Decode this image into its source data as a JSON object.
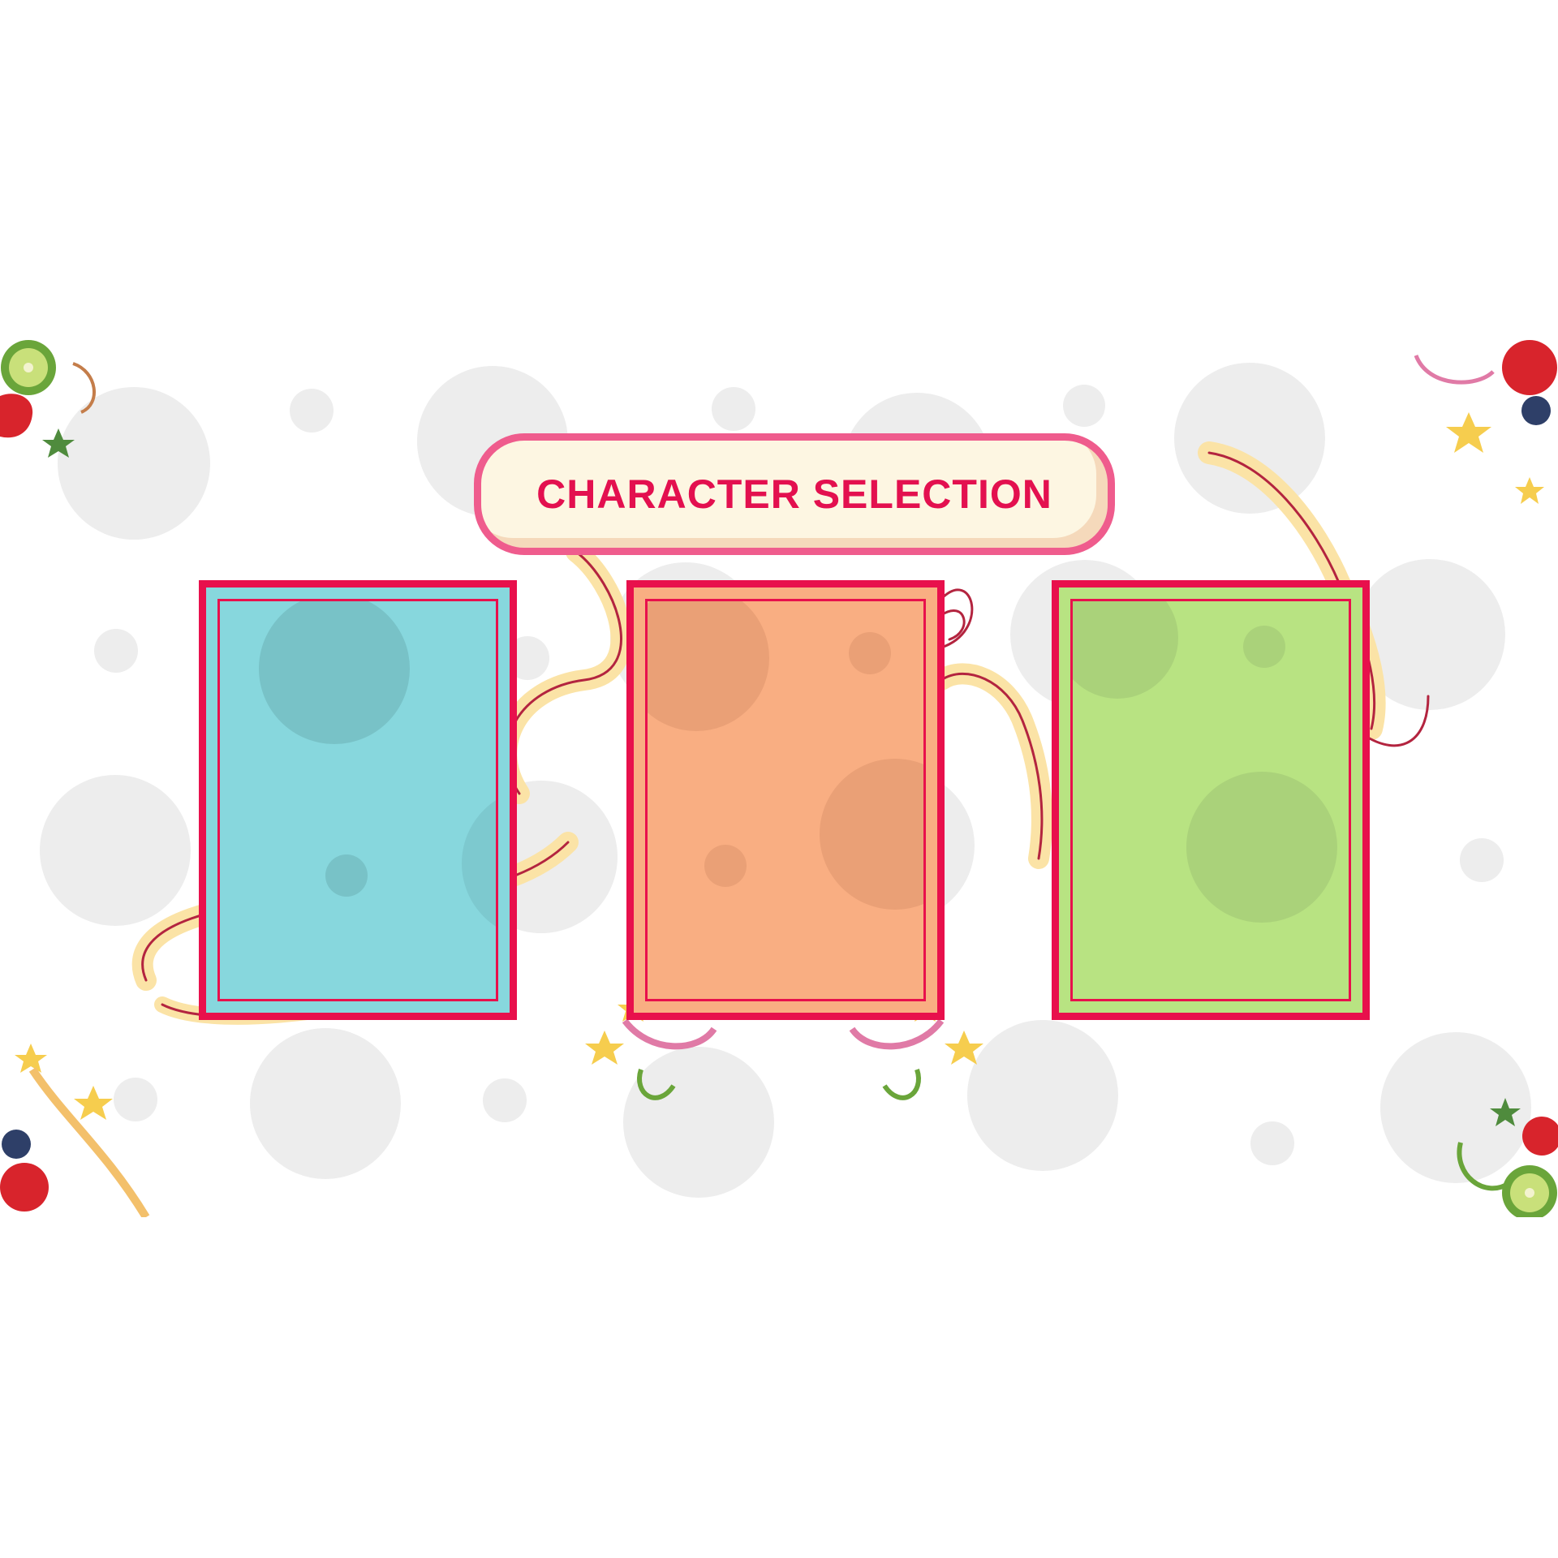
{
  "screen": {
    "title": "CHARACTER SELECTION"
  },
  "colors": {
    "title_text": "#e3104f",
    "title_border": "#ef5c8d",
    "title_fill": "#fdf6e2",
    "card_border": "#e8104c",
    "background_dots": "#ededed"
  },
  "character_slots": [
    {
      "id": "slot-1",
      "color": "#87d7dd",
      "dot_color": "#78c2c7"
    },
    {
      "id": "slot-2",
      "color": "#f9ae82",
      "dot_color": "#eaa076"
    },
    {
      "id": "slot-3",
      "color": "#b8e382",
      "dot_color": "#aad27a"
    }
  ],
  "decorations": [
    "kiwi-strawberry-corner",
    "star-swirl-ornament",
    "circle-pattern",
    "ribbon-swirls"
  ]
}
